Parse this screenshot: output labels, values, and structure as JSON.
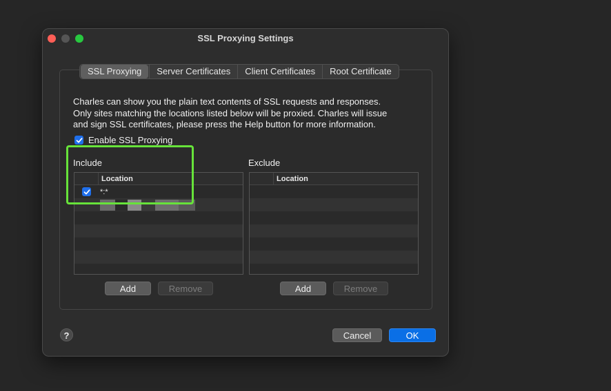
{
  "window": {
    "title": "SSL Proxying Settings"
  },
  "tabs": [
    {
      "label": "SSL Proxying",
      "active": true
    },
    {
      "label": "Server Certificates",
      "active": false
    },
    {
      "label": "Client Certificates",
      "active": false
    },
    {
      "label": "Root Certificate",
      "active": false
    }
  ],
  "description": {
    "line1": "Charles can show you the plain text contents of SSL requests and responses.",
    "line2": "Only sites matching the locations listed below will be proxied. Charles will issue",
    "line3": "and sign SSL certificates, please press the Help button for more information."
  },
  "enable_ssl": {
    "label": "Enable SSL Proxying",
    "checked": true
  },
  "include": {
    "title": "Include",
    "column_header": "Location",
    "rows": [
      {
        "enabled": true,
        "location": "*:*"
      }
    ],
    "add_label": "Add",
    "remove_label": "Remove"
  },
  "exclude": {
    "title": "Exclude",
    "column_header": "Location",
    "rows": [],
    "add_label": "Add",
    "remove_label": "Remove"
  },
  "footer": {
    "help_label": "?",
    "cancel_label": "Cancel",
    "ok_label": "OK"
  },
  "colors": {
    "primary_button": "#0a6fe6",
    "checkbox": "#1f6feb",
    "highlight": "#67e33a"
  }
}
